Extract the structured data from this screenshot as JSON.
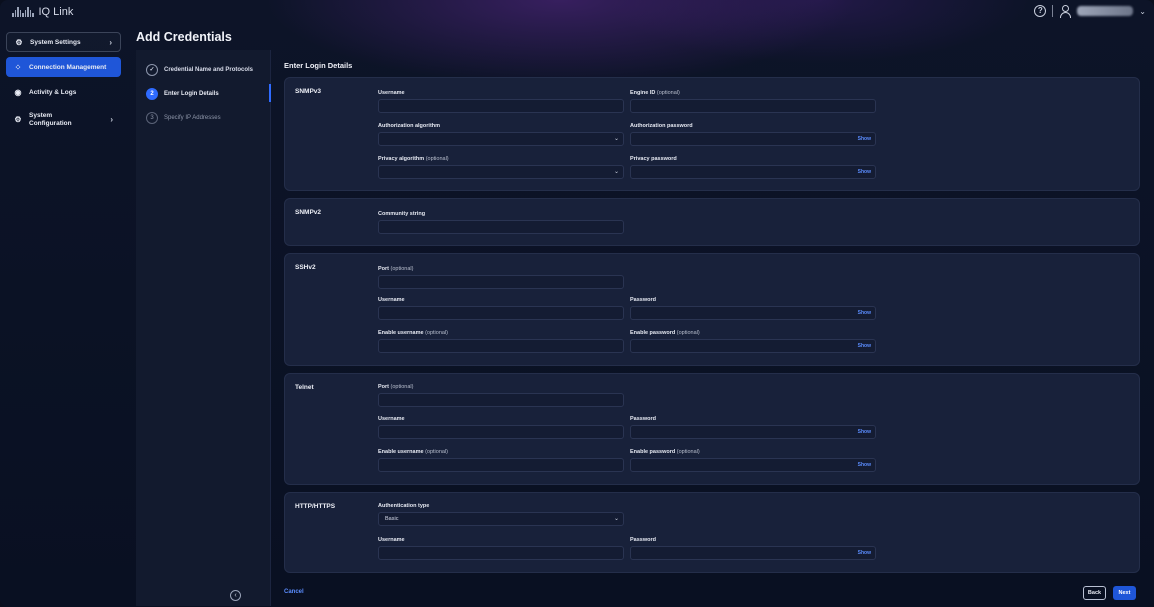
{
  "app": {
    "title": "IQ Link"
  },
  "header": {
    "help_icon": "help-circle-icon",
    "user_icon": "user-icon"
  },
  "sidebar": {
    "items": [
      {
        "label": "System Settings",
        "icon": "users-gear-icon"
      },
      {
        "label": "Connection Management",
        "icon": "connection-icon"
      },
      {
        "label": "Activity & Logs",
        "icon": "activity-icon"
      },
      {
        "label": "System Configuration",
        "icon": "gear-icon"
      }
    ]
  },
  "page": {
    "title": "Add Credentials"
  },
  "steps": [
    {
      "number": "✓",
      "label": "Credential Name and Protocols",
      "state": "done"
    },
    {
      "number": "2",
      "label": "Enter Login Details",
      "state": "current"
    },
    {
      "number": "3",
      "label": "Specify IP Addresses",
      "state": "pending"
    }
  ],
  "main": {
    "section_title": "Enter Login Details",
    "snmpv3": {
      "label": "SNMPv3",
      "username": "Username",
      "engine_id": "Engine ID",
      "auth_algorithm": "Authorization algorithm",
      "auth_password": "Authorization password",
      "privacy_algorithm": "Privacy algorithm",
      "privacy_password": "Privacy password"
    },
    "snmpv2": {
      "label": "SNMPv2",
      "community": "Community string"
    },
    "sshv2": {
      "label": "SSHv2",
      "port": "Port",
      "username": "Username",
      "password": "Password",
      "enable_username": "Enable username",
      "enable_password": "Enable password"
    },
    "telnet": {
      "label": "Telnet",
      "port": "Port",
      "username": "Username",
      "password": "Password",
      "enable_username": "Enable username",
      "enable_password": "Enable password"
    },
    "http": {
      "label": "HTTP/HTTPS",
      "auth_type": "Authentication type",
      "auth_type_value": "Basic",
      "username": "Username",
      "password": "Password"
    },
    "optional_suffix": "(optional)",
    "show_label": "Show"
  },
  "footer": {
    "cancel": "Cancel",
    "back": "Back",
    "next": "Next"
  },
  "colors": {
    "accent": "#1f56d8",
    "link": "#5b8dff",
    "card": "#18213a"
  }
}
